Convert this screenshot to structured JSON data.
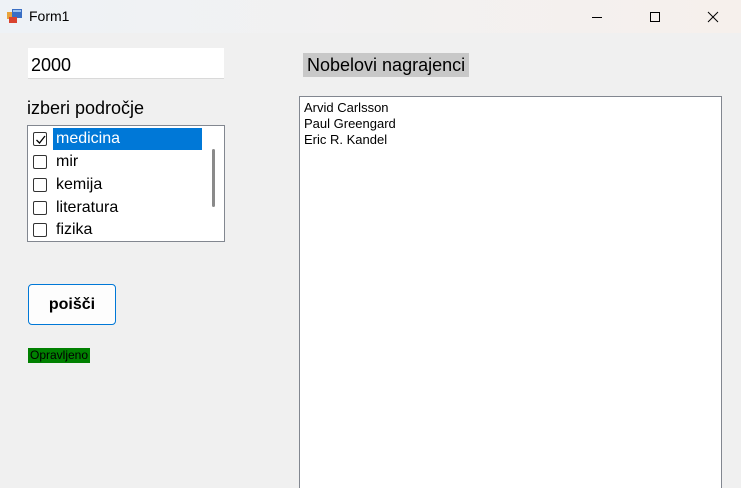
{
  "window": {
    "title": "Form1",
    "icon": "winforms-app-icon",
    "controls": [
      "minimize-icon",
      "maximize-icon",
      "close-icon"
    ]
  },
  "form": {
    "year_value": "2000",
    "field_label": "izberi področje",
    "fields": [
      {
        "label": "medicina",
        "checked": true,
        "selected": true
      },
      {
        "label": "mir",
        "checked": false,
        "selected": false
      },
      {
        "label": "kemija",
        "checked": false,
        "selected": false
      },
      {
        "label": "literatura",
        "checked": false,
        "selected": false
      },
      {
        "label": "fizika",
        "checked": false,
        "selected": false
      }
    ],
    "search_button": "poišči",
    "status": "Opravljeno"
  },
  "results": {
    "label": "Nobelovi nagrajenci",
    "items": [
      "Arvid Carlsson",
      "Paul Greengard",
      "Eric R. Kandel"
    ]
  },
  "colors": {
    "selection": "#0078d7",
    "status_bg": "#008000",
    "label_bg": "#c8c8c8"
  }
}
